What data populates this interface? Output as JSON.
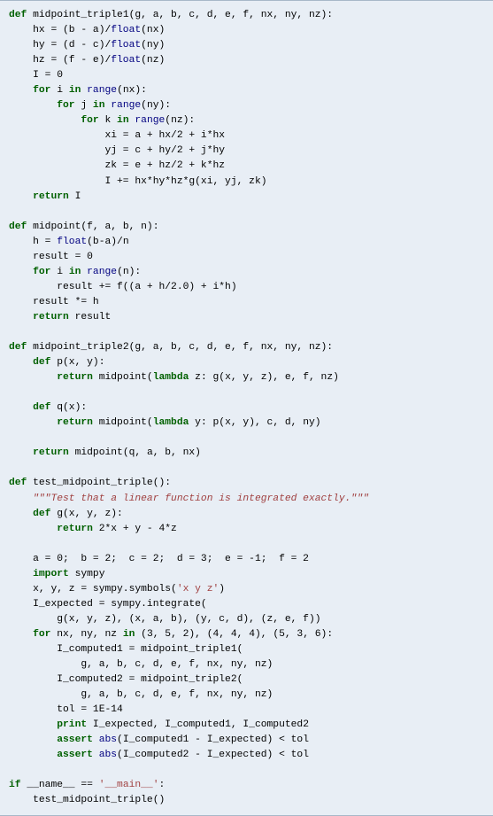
{
  "code": {
    "lines": [
      {
        "i": 0,
        "t": "def",
        "sp": " ",
        "fn": "midpoint_triple1",
        "args": "(g, a, b, c, d, e, f, nx, ny, nz):"
      },
      {
        "i": 1,
        "t": "    hx = (b - a)/",
        "bi": "float",
        "rest": "(nx)"
      },
      {
        "i": 1,
        "t": "    hy = (d - c)/",
        "bi": "float",
        "rest": "(ny)"
      },
      {
        "i": 1,
        "t": "    hz = (f - e)/",
        "bi": "float",
        "rest": "(nz)"
      },
      {
        "i": 1,
        "t": "    I = 0"
      },
      {
        "i": 1,
        "kw": "for",
        "t": "    ",
        "mid": " i ",
        "kw2": "in",
        "bi": " range",
        "rest": "(nx):"
      },
      {
        "i": 2,
        "kw": "for",
        "t": "        ",
        "mid": " j ",
        "kw2": "in",
        "bi": " range",
        "rest": "(ny):"
      },
      {
        "i": 3,
        "kw": "for",
        "t": "            ",
        "mid": " k ",
        "kw2": "in",
        "bi": " range",
        "rest": "(nz):"
      },
      {
        "i": 4,
        "t": "                xi = a + hx/2 + i*hx"
      },
      {
        "i": 4,
        "t": "                yj = c + hy/2 + j*hy"
      },
      {
        "i": 4,
        "t": "                zk = e + hz/2 + k*hz"
      },
      {
        "i": 4,
        "t": "                I += hx*hy*hz*g(xi, yj, zk)"
      },
      {
        "i": 1,
        "kw": "return",
        "t": "    ",
        "rest": " I"
      },
      {
        "blank": true
      },
      {
        "i": 0,
        "t": "def",
        "sp": " ",
        "fn": "midpoint",
        "args": "(f, a, b, n):"
      },
      {
        "i": 1,
        "t": "    h = ",
        "bi": "float",
        "rest": "(b-a)/n"
      },
      {
        "i": 1,
        "t": "    result = 0"
      },
      {
        "i": 1,
        "kw": "for",
        "t": "    ",
        "mid": " i ",
        "kw2": "in",
        "bi": " range",
        "rest": "(n):"
      },
      {
        "i": 2,
        "t": "        result += f((a + h/2.0) + i*h)"
      },
      {
        "i": 1,
        "t": "    result *= h"
      },
      {
        "i": 1,
        "kw": "return",
        "t": "    ",
        "rest": " result"
      },
      {
        "blank": true
      },
      {
        "i": 0,
        "t": "def",
        "sp": " ",
        "fn": "midpoint_triple2",
        "args": "(g, a, b, c, d, e, f, nx, ny, nz):"
      },
      {
        "i": 1,
        "t": "    ",
        "kw": "def",
        "fn": " p",
        "args": "(x, y):"
      },
      {
        "i": 2,
        "kw": "return",
        "t": "        ",
        "rest": " midpoint(",
        "lam": "lambda",
        "rest2": " z: g(x, y, z), e, f, nz)"
      },
      {
        "blank": true
      },
      {
        "i": 1,
        "t": "    ",
        "kw": "def",
        "fn": " q",
        "args": "(x):"
      },
      {
        "i": 2,
        "kw": "return",
        "t": "        ",
        "rest": " midpoint(",
        "lam": "lambda",
        "rest2": " y: p(x, y), c, d, ny)"
      },
      {
        "blank": true
      },
      {
        "i": 1,
        "kw": "return",
        "t": "    ",
        "rest": " midpoint(q, a, b, nx)"
      },
      {
        "blank": true
      },
      {
        "i": 0,
        "t": "def",
        "sp": " ",
        "fn": "test_midpoint_triple",
        "args": "():"
      },
      {
        "i": 1,
        "doc": "    \"\"\"Test that a linear function is integrated exactly.\"\"\""
      },
      {
        "i": 1,
        "t": "    ",
        "kw": "def",
        "fn": " g",
        "args": "(x, y, z):"
      },
      {
        "i": 2,
        "kw": "return",
        "t": "        ",
        "rest": " 2*x + y - 4*z"
      },
      {
        "blank": true
      },
      {
        "i": 1,
        "t": "    a = 0;  b = 2;  c = 2;  d = 3;  e = -1;  f = 2"
      },
      {
        "i": 1,
        "kw": "import",
        "t": "    ",
        "rest": " sympy"
      },
      {
        "i": 1,
        "t": "    x, y, z = sympy.symbols(",
        "str": "'x y z'",
        "rest": ")"
      },
      {
        "i": 1,
        "t": "    I_expected = sympy.integrate("
      },
      {
        "i": 2,
        "t": "        g(x, y, z), (x, a, b), (y, c, d), (z, e, f))"
      },
      {
        "i": 1,
        "kw": "for",
        "t": "    ",
        "mid": " nx, ny, nz ",
        "kw2": "in",
        "rest": " (3, 5, 2), (4, 4, 4), (5, 3, 6):"
      },
      {
        "i": 2,
        "t": "        I_computed1 = midpoint_triple1("
      },
      {
        "i": 3,
        "t": "            g, a, b, c, d, e, f, nx, ny, nz)"
      },
      {
        "i": 2,
        "t": "        I_computed2 = midpoint_triple2("
      },
      {
        "i": 3,
        "t": "            g, a, b, c, d, e, f, nx, ny, nz)"
      },
      {
        "i": 2,
        "t": "        tol = 1E-14"
      },
      {
        "i": 2,
        "t": "        ",
        "pr": "print",
        "rest": " I_expected, I_computed1, I_computed2"
      },
      {
        "i": 2,
        "t": "        ",
        "kw": "assert",
        "bi": " abs",
        "rest": "(I_computed1 - I_expected) < tol"
      },
      {
        "i": 2,
        "t": "        ",
        "kw": "assert",
        "bi": " abs",
        "rest": "(I_computed2 - I_expected) < tol"
      },
      {
        "blank": true
      },
      {
        "i": 0,
        "kw": "if",
        "t": "",
        "rest": " __name__ == ",
        "str": "'__main__'",
        "rest2": ":"
      },
      {
        "i": 1,
        "t": "    test_midpoint_triple()"
      }
    ]
  }
}
